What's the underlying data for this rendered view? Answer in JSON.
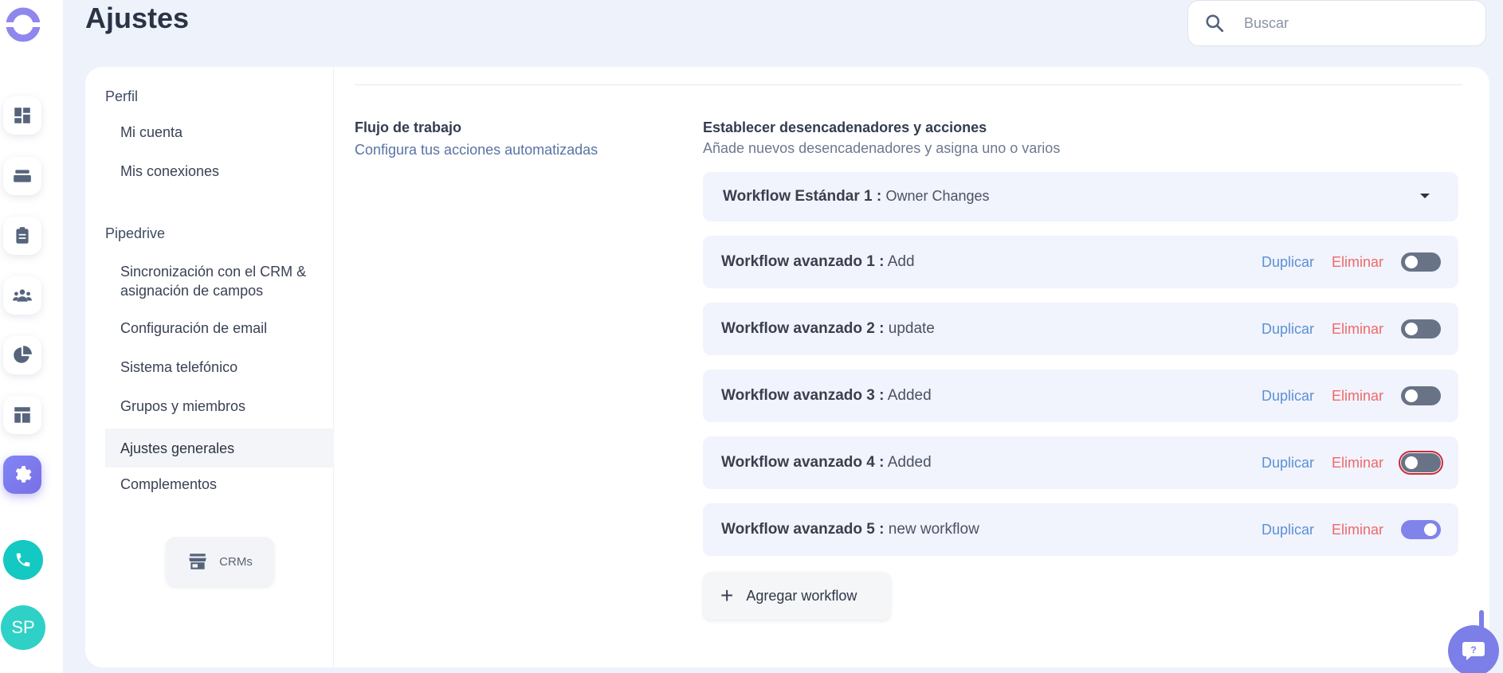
{
  "header": {
    "title": "Ajustes",
    "search_placeholder": "Buscar"
  },
  "rail": {
    "icons": [
      "dashboard-icon",
      "inbox-icon",
      "clipboard-icon",
      "team-icon",
      "pie-chart-icon",
      "layout-icon",
      "gear-icon"
    ],
    "active": "gear-icon",
    "avatar_initials": "SP"
  },
  "settings_nav": {
    "sections": [
      {
        "title": "Perfil",
        "items": [
          "Mi cuenta",
          "Mis conexiones"
        ]
      },
      {
        "title": "Pipedrive",
        "items": [
          "Sincronización con el CRM & asignación de campos",
          "Configuración de email",
          "Sistema telefónico",
          "Grupos y miembros",
          "Ajustes generales",
          "Complementos"
        ]
      }
    ],
    "active_item": "Ajustes generales",
    "crms_label": "CRMs"
  },
  "content": {
    "workflow_title": "Flujo de trabajo",
    "workflow_sub": "Configura tus acciones automatizadas",
    "triggers_title": "Establecer desencadenadores y acciones",
    "triggers_sub": "Añade nuevos desencadenadores y asigna uno o varios",
    "standard_workflow": {
      "label": "Workflow Estándar 1 :",
      "name": "Owner Changes"
    },
    "advanced_workflows": [
      {
        "label": "Workflow avanzado 1 :",
        "name": "Add",
        "enabled": false
      },
      {
        "label": "Workflow avanzado 2 :",
        "name": "update",
        "enabled": false
      },
      {
        "label": "Workflow avanzado 3 :",
        "name": "Added",
        "enabled": false
      },
      {
        "label": "Workflow avanzado 4 :",
        "name": "Added",
        "enabled": false
      },
      {
        "label": "Workflow avanzado 5 :",
        "name": "new workflow",
        "enabled": true
      }
    ],
    "duplicate_label": "Duplicar",
    "delete_label": "Eliminar",
    "add_workflow_label": "Agregar workflow"
  },
  "colors": {
    "accent": "#7f83ea",
    "link": "#5b91d4",
    "danger": "#ee6a6a",
    "row_bg": "#f1f3fd"
  }
}
